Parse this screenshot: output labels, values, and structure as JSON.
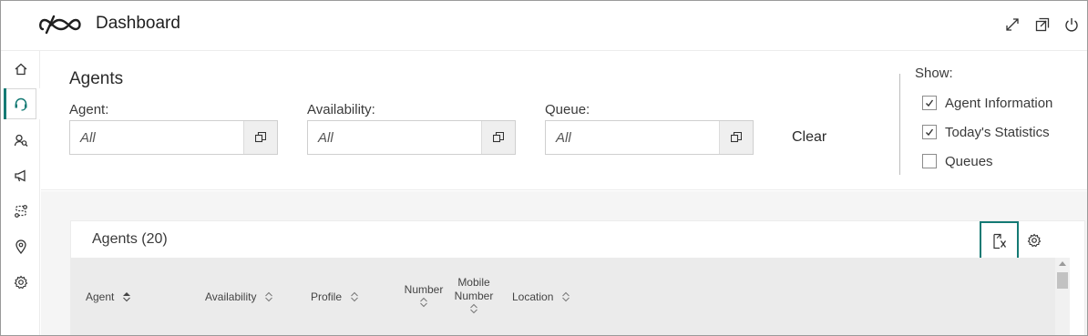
{
  "header": {
    "title": "Dashboard",
    "icons": [
      "logo-icon",
      "expand-icon",
      "popout-icon",
      "power-icon"
    ]
  },
  "rail": {
    "items": [
      "home-icon",
      "headset-icon",
      "agent-search-icon",
      "megaphone-icon",
      "route-icon",
      "location-pin-icon",
      "settings-icon"
    ],
    "active": "headset-icon"
  },
  "filters": {
    "title": "Agents",
    "agent": {
      "label": "Agent:",
      "value": "All"
    },
    "availability": {
      "label": "Availability:",
      "value": "All"
    },
    "queue": {
      "label": "Queue:",
      "value": "All"
    },
    "clear_label": "Clear"
  },
  "show": {
    "label": "Show:",
    "options": [
      {
        "label": "Agent Information",
        "checked": true
      },
      {
        "label": "Today's Statistics",
        "checked": true
      },
      {
        "label": "Queues",
        "checked": false
      }
    ]
  },
  "table": {
    "title": "Agents (20)",
    "columns": {
      "agent": "Agent",
      "availability": "Availability",
      "profile": "Profile",
      "number": "Number",
      "mobile_number_line1": "Mobile",
      "mobile_number_line2": "Number",
      "location": "Location"
    },
    "sorted_column": "Agent"
  },
  "colors": {
    "accent": "#147a74",
    "header_bg": "#ebebeb",
    "content_bg": "#f5f5f5"
  }
}
